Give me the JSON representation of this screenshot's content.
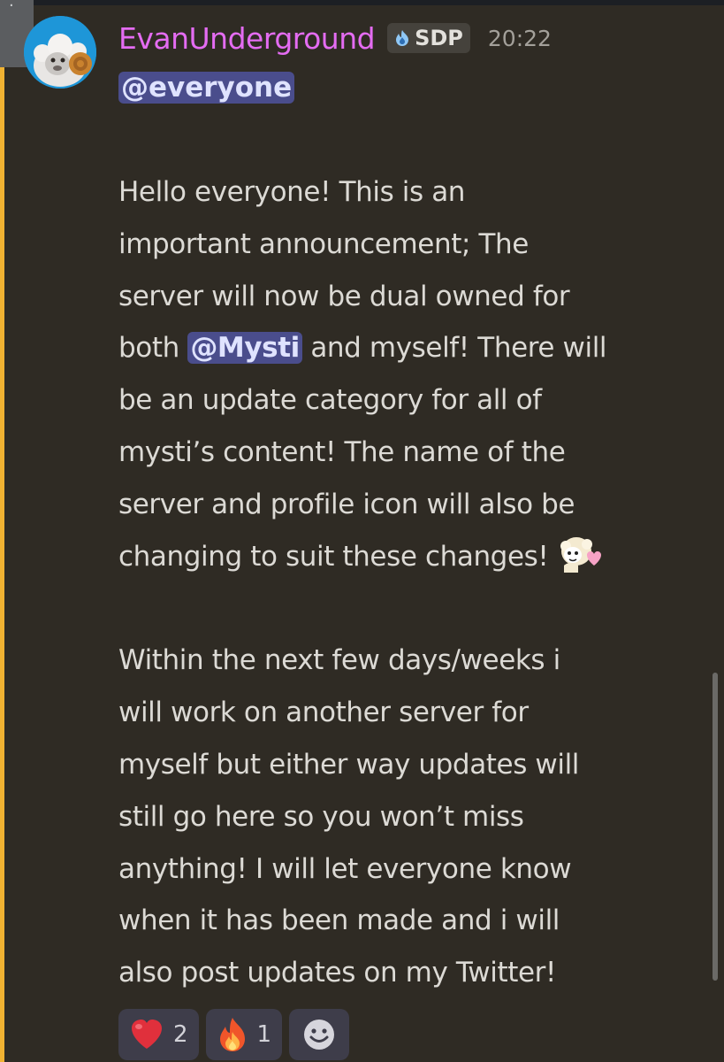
{
  "message": {
    "username": "EvanUnderground",
    "server_tag": "SDP",
    "timestamp": "20:22",
    "mention_everyone": "@everyone",
    "paragraph1": {
      "line1": "Hello everyone! This is an",
      "line2": "important announcement; The",
      "line3": "server will now be dual owned for",
      "line4_before": "both ",
      "line4_mention": "@Mysti",
      "line4_after": " and myself! There will",
      "line5": "be an update category for all of",
      "line6": "mysti’s content! The name of the",
      "line7": "server and profile icon will also be",
      "line8": "changing to suit these changes!"
    },
    "paragraph2": {
      "line1": "Within the next few days/weeks i",
      "line2": "will work on another server for",
      "line3": "myself but either way updates will",
      "line4": "still go here so you won’t miss",
      "line5": "anything! I will let everyone know",
      "line6": "when it has been made and i will",
      "line7": "also post updates on my Twitter!"
    }
  },
  "reactions": [
    {
      "icon": "red-heart-icon",
      "count": "2"
    },
    {
      "icon": "fire-icon",
      "count": "1"
    },
    {
      "icon": "add-reaction-icon"
    }
  ],
  "colors": {
    "background": "#2f2b24",
    "username": "#e46cf2",
    "mention_bg": "#4a4d8c",
    "mention_bar": "#f0b232",
    "text": "#dcdad5",
    "timestamp": "#a3a09a"
  }
}
